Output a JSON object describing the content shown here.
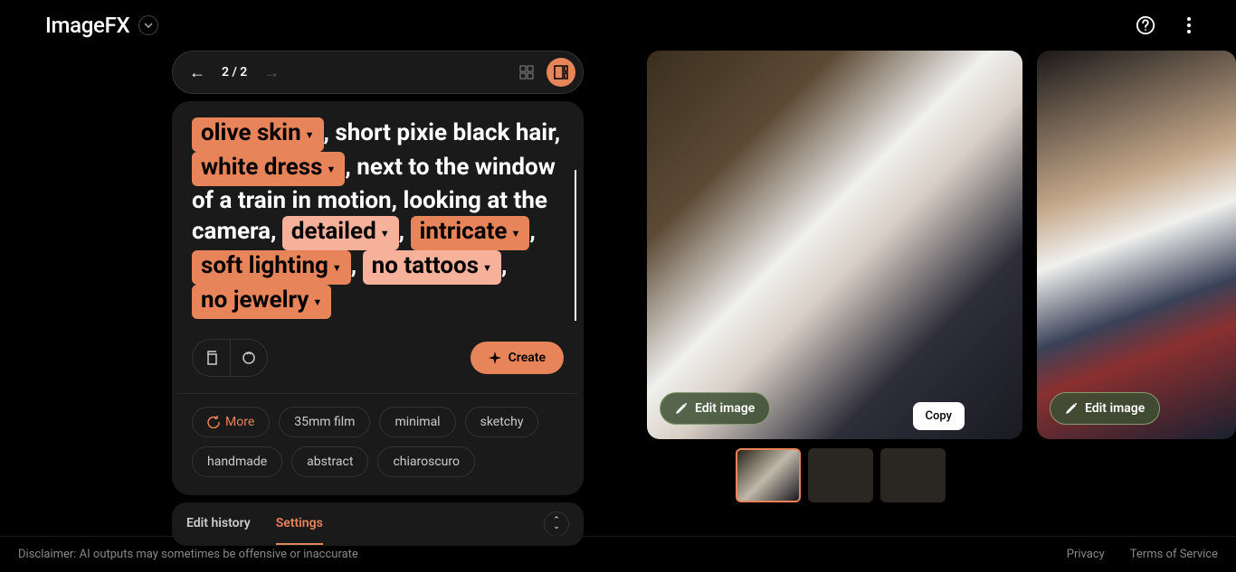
{
  "header": {
    "logo": "ImageFX"
  },
  "nav": {
    "pageIndicator": "2 / 2"
  },
  "prompt": {
    "chips": {
      "oliveSkin": "olive skin",
      "whiteDress": "white dress",
      "detailed": "detailed",
      "intricate": "intricate",
      "softLighting": "soft lighting",
      "noTattoos": "no tattoos",
      "noJewelry": "no jewelry"
    },
    "text": {
      "seg1": ", short pixie black hair, ",
      "seg2": ", next to the window of a train in motion, looking at the camera, ",
      "seg3": ", ",
      "seg4": ", ",
      "seg5": ", ",
      "seg6": ", "
    },
    "moreLabel": "More",
    "createLabel": "Create",
    "suggestions": [
      "35mm film",
      "minimal",
      "sketchy",
      "handmade",
      "abstract",
      "chiaroscuro"
    ]
  },
  "tabs": {
    "editHistory": "Edit history",
    "settings": "Settings"
  },
  "images": {
    "editLabel": "Edit image",
    "copyTooltip": "Copy"
  },
  "footer": {
    "disclaimer": "Disclaimer: AI outputs may sometimes be offensive or inaccurate",
    "privacy": "Privacy",
    "terms": "Terms of Service"
  }
}
